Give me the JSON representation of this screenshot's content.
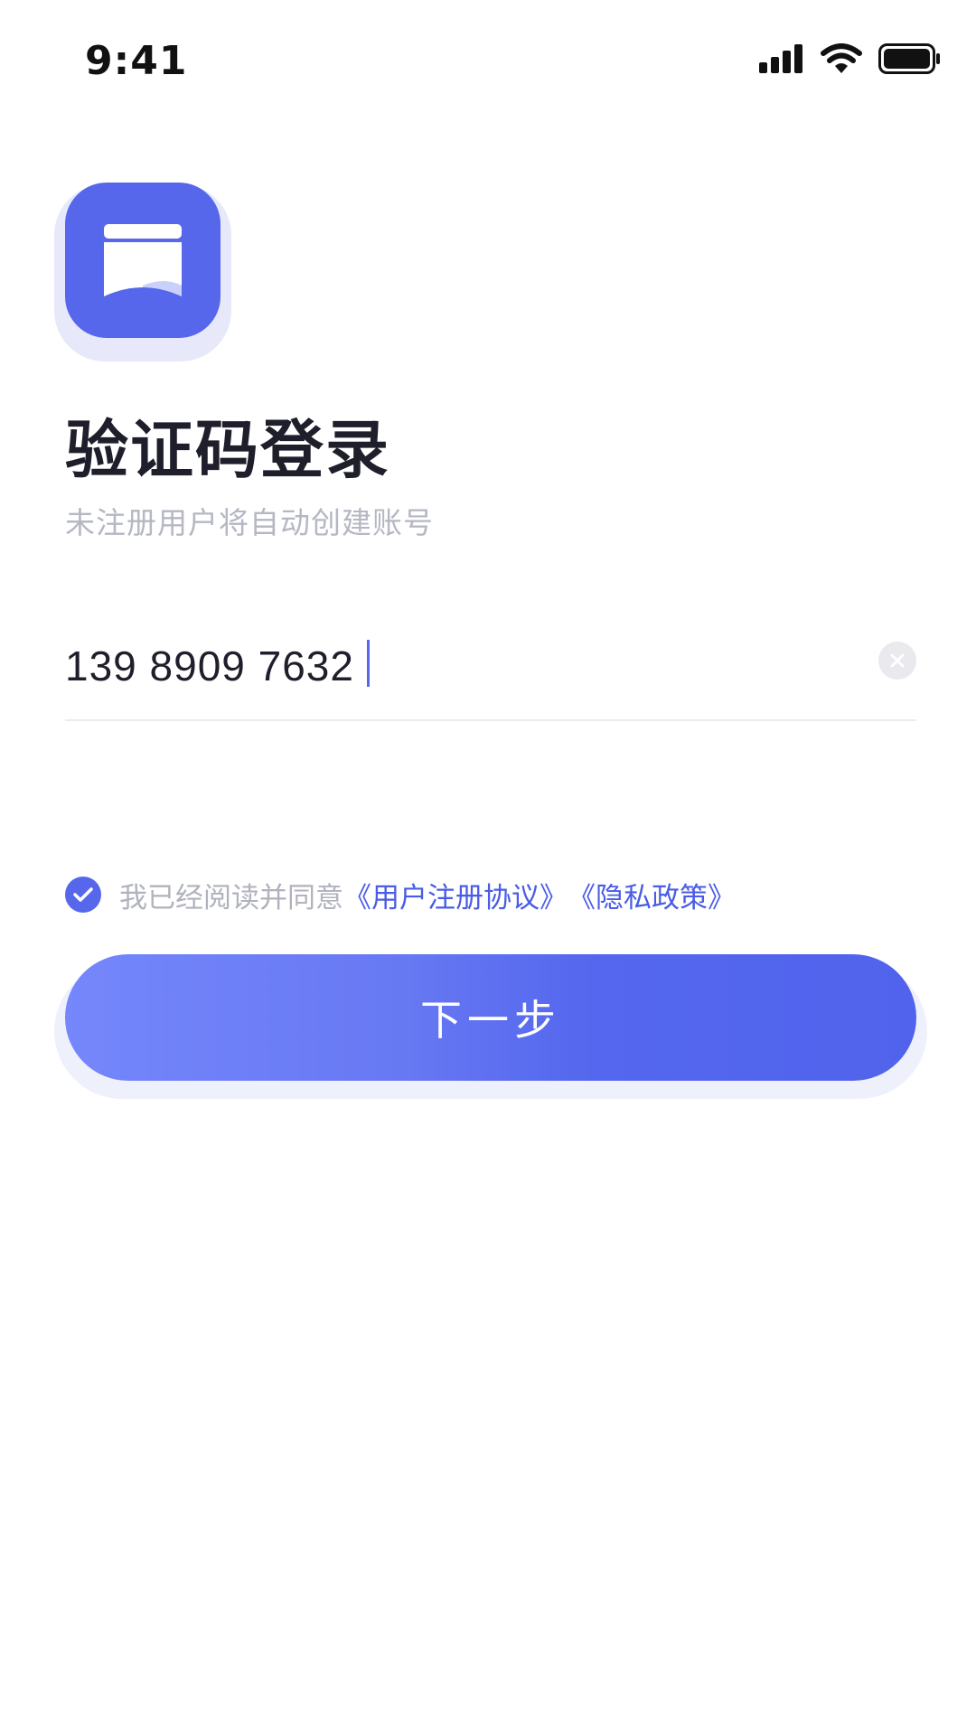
{
  "status_bar": {
    "time": "9:41",
    "icons": [
      "signal-icon",
      "wifi-icon",
      "battery-icon"
    ]
  },
  "app": {
    "logo_icon": "app-logo-icon",
    "accent_color": "#5667ec"
  },
  "login": {
    "title": "验证码登录",
    "subtitle": "未注册用户将自动创建账号",
    "phone_value": "139 8909 7632",
    "clear_icon": "close-icon"
  },
  "agreement": {
    "checked": true,
    "text": "我已经阅读并同意",
    "user_agreement_link": "《用户注册协议》",
    "privacy_policy_link": "《隐私政策》"
  },
  "next_button": {
    "label": "下一步"
  }
}
